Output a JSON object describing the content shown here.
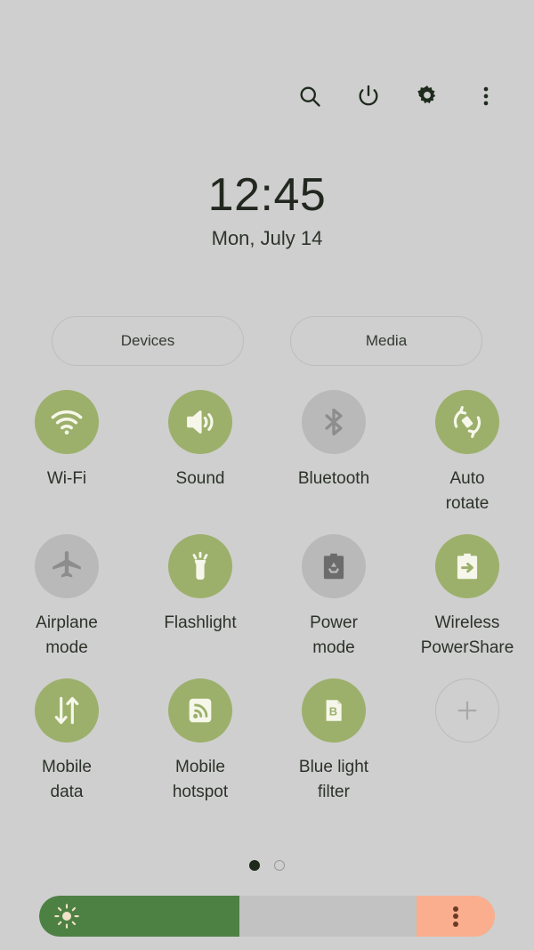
{
  "topbar": {
    "icons": [
      {
        "name": "search-icon",
        "label": "Search"
      },
      {
        "name": "power-icon",
        "label": "Power off"
      },
      {
        "name": "gear-icon",
        "label": "Settings"
      },
      {
        "name": "overflow-menu-icon",
        "label": "More options"
      }
    ]
  },
  "clock": {
    "time": "12:45",
    "date": "Mon, July 14"
  },
  "pills": [
    {
      "label": "Devices"
    },
    {
      "label": "Media"
    }
  ],
  "tiles": [
    {
      "label": "Wi-Fi",
      "icon": "wifi-icon",
      "state": "on"
    },
    {
      "label": "Sound",
      "icon": "sound-icon",
      "state": "on"
    },
    {
      "label": "Bluetooth",
      "icon": "bluetooth-icon",
      "state": "off"
    },
    {
      "label": "Auto\nrotate",
      "icon": "auto-rotate-icon",
      "state": "on"
    },
    {
      "label": "Airplane\nmode",
      "icon": "airplane-icon",
      "state": "off"
    },
    {
      "label": "Flashlight",
      "icon": "flashlight-icon",
      "state": "on"
    },
    {
      "label": "Power\nmode",
      "icon": "power-mode-icon",
      "state": "off"
    },
    {
      "label": "Wireless\nPowerShare",
      "icon": "wireless-powershare-icon",
      "state": "on"
    },
    {
      "label": "Mobile\ndata",
      "icon": "mobile-data-icon",
      "state": "on"
    },
    {
      "label": "Mobile\nhotspot",
      "icon": "mobile-hotspot-icon",
      "state": "on"
    },
    {
      "label": "Blue light\nfilter",
      "icon": "blue-light-filter-icon",
      "state": "on"
    },
    {
      "label": "",
      "icon": "add-icon",
      "state": "add"
    }
  ],
  "pager": {
    "pages": 2,
    "current": 1
  },
  "brightness": {
    "icon": "brightness-sun-icon",
    "percent": 44,
    "menu_icon": "brightness-options-icon"
  },
  "colors": {
    "background": "#cfcfcf",
    "tile_on": "#9cb06b",
    "tile_off": "#b9b9b9",
    "slider_fill": "#4d8143",
    "slider_track": "#c2c2c2",
    "slider_menu": "#faae8e",
    "text": "#2c322a"
  }
}
